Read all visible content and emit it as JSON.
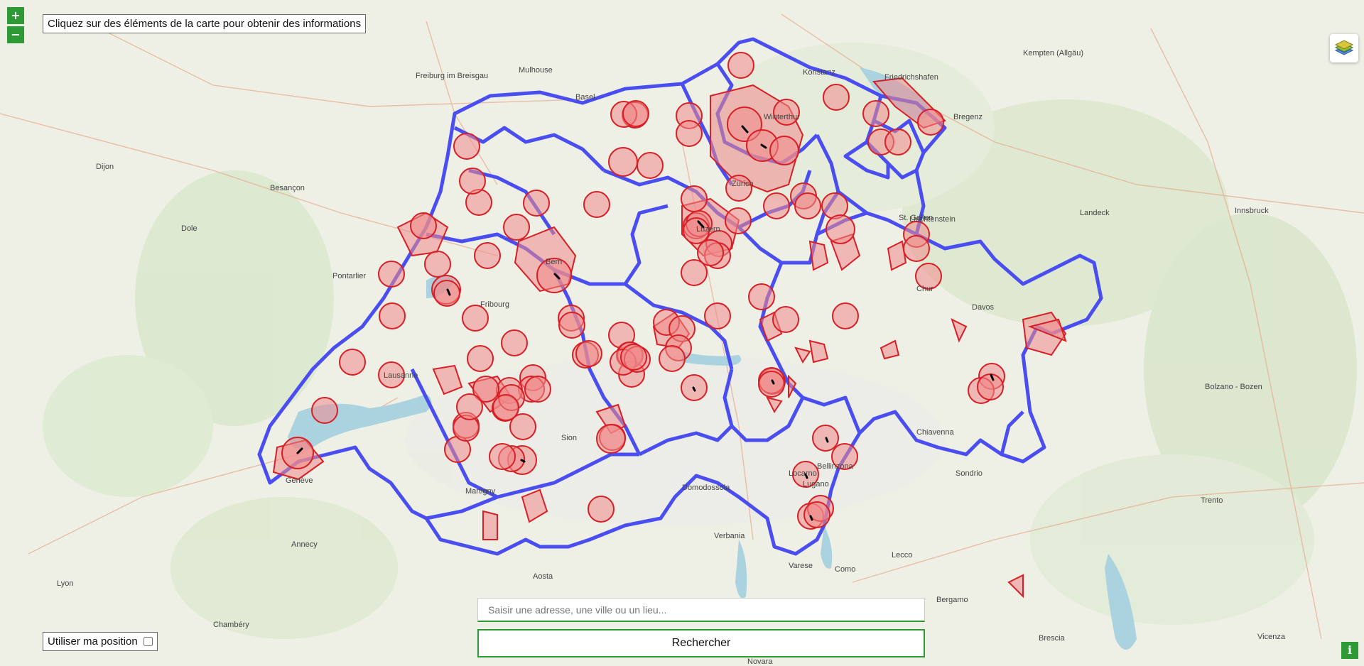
{
  "map": {
    "zoom_in_label": "+",
    "zoom_out_label": "−",
    "info_text": "Cliquez sur des éléments de la carte pour obtenir des informations",
    "layers_icon": "layers-icon",
    "colors": {
      "border": "#4a4ef0",
      "zone_fill": "#f08a8a",
      "zone_stroke": "#d81f26",
      "accent": "#2e9a36",
      "lake": "#aad3df"
    },
    "place_labels": {
      "mulhouse": "Mulhouse",
      "dijon": "Dijon",
      "besancon": "Besançon",
      "dole": "Dole",
      "pontarlier": "Pontarlier",
      "geneve": "Genève",
      "lausanne": "Lausanne",
      "fribourg": "Fribourg",
      "bern": "Bern",
      "basel": "Basel",
      "zurich": "Zürich",
      "winterthur": "Winterthur",
      "luzern": "Luzern",
      "st_gallen": "St. Gallen",
      "chur": "Chur",
      "davos": "Davos",
      "lugano": "Lugano",
      "locarno": "Locarno",
      "bellinzona": "Bellinzona",
      "sion": "Sion",
      "martigny": "Martigny",
      "annecy": "Annecy",
      "lyon": "Lyon",
      "chambery": "Chambéry",
      "como": "Como",
      "varese": "Varese",
      "bergamo": "Bergamo",
      "brescia": "Brescia",
      "trento": "Trento",
      "bolzano": "Bolzano - Bozen",
      "innsbruck": "Innsbruck",
      "bregenz": "Bregenz",
      "konstanz": "Konstanz",
      "friedrichshafen": "Friedrichshafen",
      "sondrio": "Sondrio",
      "domodossola": "Domodossola",
      "verbania": "Verbania",
      "novara": "Novara",
      "vicenza": "Vicenza",
      "liechtenstein": "Liechtenstein",
      "kempten": "Kempten (Allgäu)",
      "freiburg": "Freiburg im Breisgau",
      "aosta": "Aosta",
      "lecco": "Lecco",
      "chiavenna": "Chiavenna",
      "landeck": "Landeck"
    }
  },
  "location": {
    "label": "Utiliser ma position"
  },
  "search": {
    "placeholder": "Saisir une adresse, une ville ou un lieu...",
    "button_label": "Rechercher"
  },
  "info_button": {
    "label": "i"
  }
}
